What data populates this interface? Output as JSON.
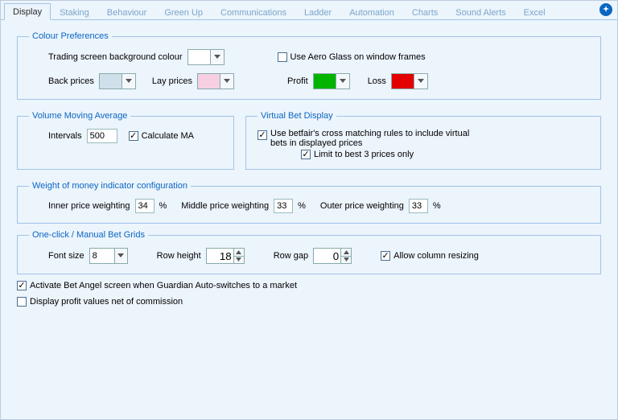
{
  "tabs": [
    "Display",
    "Staking",
    "Behaviour",
    "Green Up",
    "Communications",
    "Ladder",
    "Automation",
    "Charts",
    "Sound Alerts",
    "Excel"
  ],
  "activeTabIndex": 0,
  "colourPrefs": {
    "legend": "Colour Preferences",
    "bgLabel": "Trading screen background colour",
    "bgColour": "#FFFFFF",
    "aeroLabel": "Use Aero Glass on window frames",
    "aeroChecked": false,
    "backPricesLabel": "Back prices",
    "backPricesColour": "#CFE0EB",
    "layPricesLabel": "Lay prices",
    "layPricesColour": "#F7CFE3",
    "profitLabel": "Profit",
    "profitColour": "#00B400",
    "lossLabel": "Loss",
    "lossColour": "#E30000"
  },
  "vma": {
    "legend": "Volume Moving Average",
    "intervalsLabel": "Intervals",
    "intervalsValue": "500",
    "calcLabel": "Calculate MA",
    "calcChecked": true
  },
  "vbd": {
    "legend": "Virtual Bet Display",
    "rule1Label": "Use betfair's cross matching rules to include virtual bets in displayed prices",
    "rule1Checked": true,
    "rule2Label": "Limit to best 3 prices only",
    "rule2Checked": true
  },
  "wom": {
    "legend": "Weight of money indicator configuration",
    "innerLabel": "Inner price weighting",
    "innerValue": "34",
    "middleLabel": "Middle price weighting",
    "middleValue": "33",
    "outerLabel": "Outer price weighting",
    "outerValue": "33",
    "pct": "%"
  },
  "grids": {
    "legend": "One-click / Manual Bet Grids",
    "fontSizeLabel": "Font size",
    "fontSizeValue": "8",
    "rowHeightLabel": "Row height",
    "rowHeightValue": "18",
    "rowGapLabel": "Row gap",
    "rowGapValue": "0",
    "allowResizeLabel": "Allow column resizing",
    "allowResizeChecked": true
  },
  "bottom": {
    "activateLabel": "Activate Bet Angel screen when Guardian Auto-switches to a market",
    "activateChecked": true,
    "netCommLabel": "Display profit values net of commission",
    "netCommChecked": false
  }
}
